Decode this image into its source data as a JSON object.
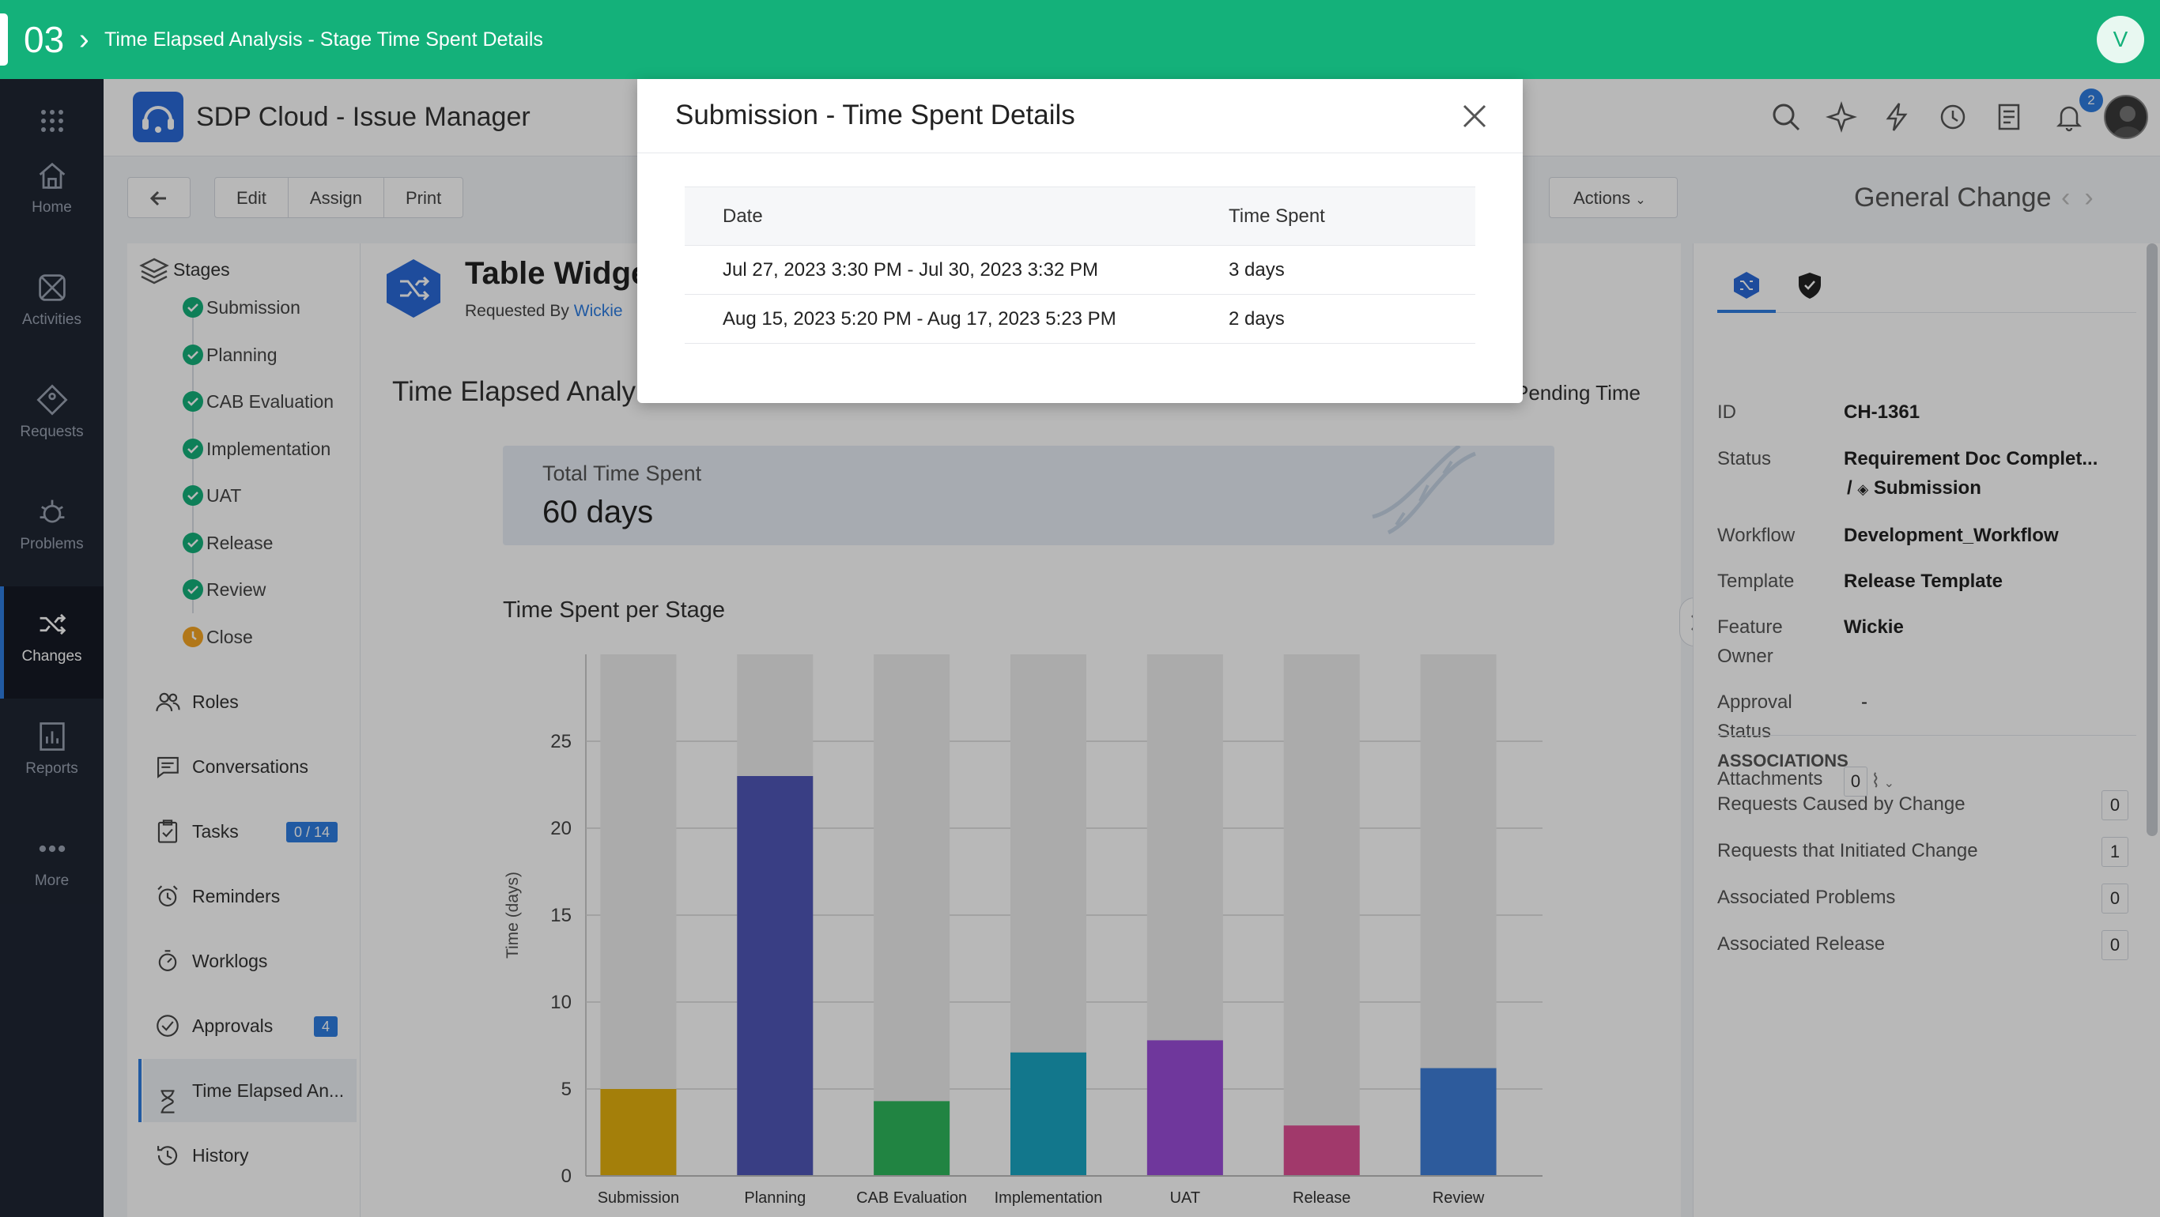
{
  "tour": {
    "step": "03",
    "title": "Time Elapsed Analysis - Stage Time Spent Details",
    "user_initial": "V"
  },
  "nav": [
    {
      "label": "Home",
      "icon": "home-icon"
    },
    {
      "label": "Activities",
      "icon": "activities-icon"
    },
    {
      "label": "Requests",
      "icon": "requests-icon"
    },
    {
      "label": "Problems",
      "icon": "problems-icon"
    },
    {
      "label": "Changes",
      "icon": "changes-icon",
      "active": true
    },
    {
      "label": "Reports",
      "icon": "reports-icon"
    },
    {
      "label": "More",
      "icon": "more-icon"
    }
  ],
  "app": {
    "title": "SDP Cloud - Issue Manager",
    "notification_count": "2"
  },
  "toolbar": {
    "edit": "Edit",
    "assign": "Assign",
    "print": "Print",
    "actions": "Actions",
    "record_type": "General Change"
  },
  "side_menu": {
    "stages_label": "Stages",
    "stages": [
      {
        "name": "Submission",
        "state": "done"
      },
      {
        "name": "Planning",
        "state": "done"
      },
      {
        "name": "CAB Evaluation",
        "state": "done"
      },
      {
        "name": "Implementation",
        "state": "done"
      },
      {
        "name": "UAT",
        "state": "done"
      },
      {
        "name": "Release",
        "state": "done"
      },
      {
        "name": "Review",
        "state": "done"
      },
      {
        "name": "Close",
        "state": "pending"
      }
    ],
    "items": [
      {
        "label": "Roles",
        "icon": "roles-icon",
        "badge": ""
      },
      {
        "label": "Conversations",
        "icon": "conversations-icon",
        "badge": ""
      },
      {
        "label": "Tasks",
        "icon": "tasks-icon",
        "badge": "0 / 14"
      },
      {
        "label": "Reminders",
        "icon": "reminders-icon",
        "badge": ""
      },
      {
        "label": "Worklogs",
        "icon": "worklogs-icon",
        "badge": ""
      },
      {
        "label": "Approvals",
        "icon": "approvals-icon",
        "badge": "4"
      },
      {
        "label": "Time Elapsed An...",
        "icon": "hourglass-icon",
        "badge": "",
        "active": true
      },
      {
        "label": "History",
        "icon": "history-icon",
        "badge": ""
      }
    ]
  },
  "content": {
    "title": "Table Widge",
    "requested_by_label": "Requested By",
    "requested_by": "Wickie",
    "section_title": "Time Elapsed Analy",
    "pending_tab": "Pending Time",
    "total_label": "Total Time Spent",
    "total_value": "60 days",
    "chart_title": "Time Spent per Stage"
  },
  "chart_data": {
    "type": "bar",
    "ylabel": "Time (days)",
    "ylim": [
      0,
      30
    ],
    "yticks": [
      0,
      5,
      10,
      15,
      20,
      25
    ],
    "categories": [
      "Submission",
      "Planning",
      "CAB Evaluation",
      "Implementation",
      "UAT",
      "Release",
      "Review"
    ],
    "values": [
      5,
      23,
      4.3,
      7.1,
      7.8,
      2.9,
      6.2
    ],
    "colors": [
      "#e4b00e",
      "#4f56b8",
      "#2fb75c",
      "#1aa6c2",
      "#9a4dd8",
      "#e04f95",
      "#3f7fd8"
    ],
    "background_bar_color": "#ededed"
  },
  "details": {
    "id_label": "ID",
    "id": "CH-1361",
    "status_label": "Status",
    "status": "Requirement Doc Complet...",
    "status_sub": "Submission",
    "workflow_label": "Workflow",
    "workflow": "Development_Workflow",
    "template_label": "Template",
    "template": "Release Template",
    "feature_owner_label_1": "Feature",
    "feature_owner_label_2": "Owner",
    "feature_owner": "Wickie",
    "approval_label_1": "Approval",
    "approval_label_2": "Status",
    "approval": "-",
    "attachments_label": "Attachments",
    "attachments": "0",
    "associations_title": "ASSOCIATIONS",
    "associations": [
      {
        "label": "Requests Caused by Change",
        "count": "0"
      },
      {
        "label": "Requests that Initiated Change",
        "count": "1"
      },
      {
        "label": "Associated Problems",
        "count": "0"
      },
      {
        "label": "Associated Release",
        "count": "0"
      }
    ]
  },
  "modal": {
    "title": "Submission - Time Spent Details",
    "columns": [
      "Date",
      "Time Spent"
    ],
    "rows": [
      {
        "date": "Jul 27, 2023 3:30 PM - Jul 30, 2023 3:32 PM",
        "time": "3 days"
      },
      {
        "date": "Aug 15, 2023 5:20 PM - Aug 17, 2023 5:23 PM",
        "time": "2 days"
      }
    ]
  }
}
